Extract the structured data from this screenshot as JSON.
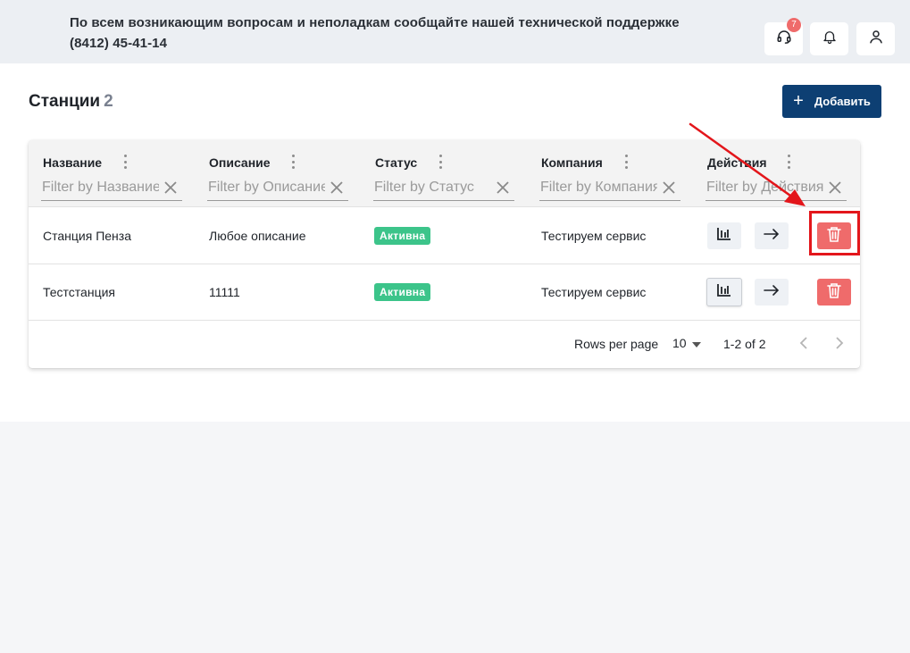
{
  "header": {
    "support_text": "По всем возникающим вопросам и неполадкам сообщайте нашей технической поддержке (8412) 45-41-14",
    "support_badge": "7",
    "icons": [
      "headset-icon",
      "bell-icon",
      "user-icon"
    ]
  },
  "page": {
    "title": "Станции",
    "count": "2",
    "add_label": "Добавить"
  },
  "table": {
    "columns": [
      {
        "label": "Название",
        "filter_placeholder": "Filter by Название"
      },
      {
        "label": "Описание",
        "filter_placeholder": "Filter by Описание"
      },
      {
        "label": "Статус",
        "filter_placeholder": "Filter by Статус"
      },
      {
        "label": "Компания",
        "filter_placeholder": "Filter by Компания"
      },
      {
        "label": "Действия",
        "filter_placeholder": "Filter by Действия"
      }
    ],
    "rows": [
      {
        "name": "Станция Пенза",
        "description": "Любое описание",
        "status": "Активна",
        "company": "Тестируем сервис"
      },
      {
        "name": "Тестстанция",
        "description": "11111",
        "status": "Активна",
        "company": "Тестируем сервис"
      }
    ],
    "footer": {
      "rows_per_page_label": "Rows per page",
      "rows_per_page_value": "10",
      "range": "1-2 of 2"
    }
  },
  "colors": {
    "primary": "#0d3f73",
    "status_active": "#3cc48a",
    "danger": "#ef6b6b",
    "annotation": "#e3161b"
  }
}
